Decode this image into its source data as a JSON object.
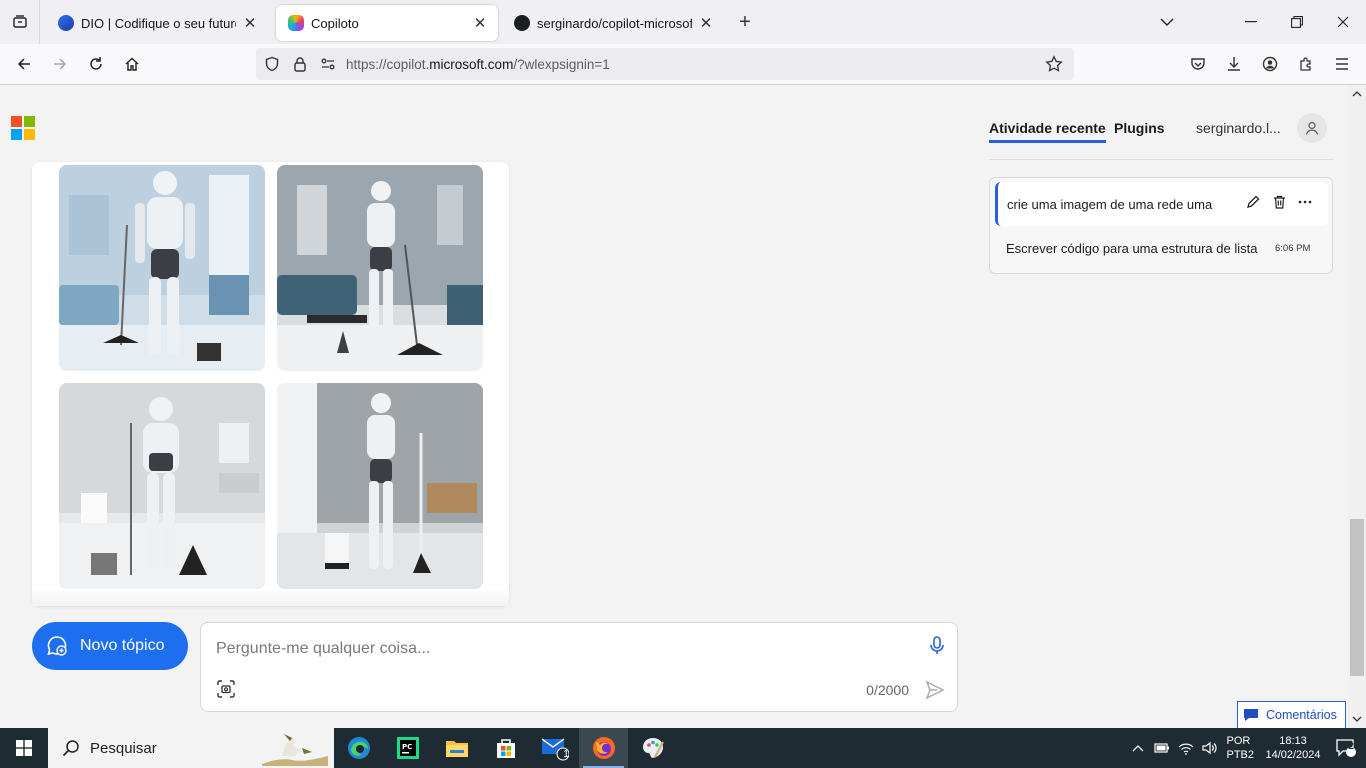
{
  "browser": {
    "tabs": [
      {
        "title": "DIO | Codifique o seu futuro glo",
        "favicon": "dio-icon",
        "active": false
      },
      {
        "title": "Copiloto",
        "favicon": "copilot-icon",
        "active": true
      },
      {
        "title": "serginardo/copilot-microsoft",
        "favicon": "github-icon",
        "active": false
      }
    ],
    "url_prefix": "https://copilot.",
    "url_host": "microsoft.com",
    "url_suffix": "/?wlexpsignin=1"
  },
  "sidebar": {
    "tab_recent": "Atividade recente",
    "tab_plugins": "Plugins",
    "user_name": "serginardo.l...",
    "recent": [
      {
        "text": "crie uma imagem de uma rede uma",
        "time": ""
      },
      {
        "text": "Escrever código para uma estrutura de lista",
        "time": "6:06 PM"
      }
    ]
  },
  "composer": {
    "new_topic_label": "Novo tópico",
    "placeholder": "Pergunte-me qualquer coisa...",
    "counter": "0/2000"
  },
  "feedback_label": "Comentários",
  "taskbar": {
    "search_label": "Pesquisar",
    "mail_badge": "1",
    "lang_line1": "POR",
    "lang_line2": "PTB2",
    "time": "18:13",
    "date": "14/02/2024",
    "notif_count": "2"
  },
  "colors": {
    "accent": "#1d6ff0",
    "taskbar": "#1f2b32"
  }
}
